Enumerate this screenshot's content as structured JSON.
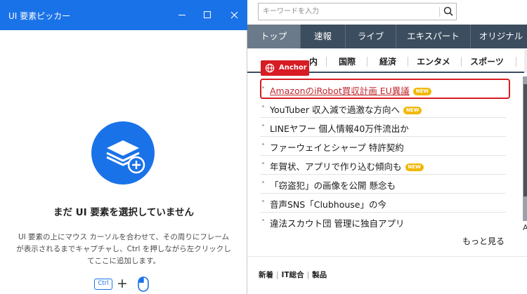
{
  "picker": {
    "title": "UI 要素ピッカー",
    "empty_heading": "まだ UI 要素を選択していません",
    "empty_description": "UI 要素の上にマウス カーソルを合わせて、その周りにフレームが表示されるまでキャプチャし、Ctrl を押しながら左クリックしてここに追加します。",
    "ctrl_key_label": "Ctrl",
    "plus_label": "+",
    "icons": {
      "hero": "stacked-layers-add-icon",
      "mouse": "mouse-left-click-icon"
    },
    "accent_color": "#1a72e8"
  },
  "browser": {
    "search": {
      "placeholder": "キーワードを入力",
      "value": ""
    },
    "nav_primary": [
      {
        "label": "トップ",
        "active": true
      },
      {
        "label": "速報",
        "active": false
      },
      {
        "label": "ライブ",
        "active": false
      },
      {
        "label": "エキスパート",
        "active": false
      },
      {
        "label": "オリジナル",
        "active": false
      }
    ],
    "nav_secondary": [
      "国内",
      "国際",
      "経済",
      "エンタメ",
      "スポーツ"
    ],
    "nav_secondary_first_partial": "内",
    "anchor_badge": {
      "label": "Anchor",
      "color": "#d71c24"
    },
    "news": [
      {
        "title": "AmazonのiRobot買収計画 EU異議",
        "new": true,
        "highlighted": true
      },
      {
        "title": "YouTuber 収入減で過激な方向へ",
        "new": true,
        "highlighted": false
      },
      {
        "title": "LINEヤフー 個人情報40万件流出か",
        "new": false,
        "highlighted": false
      },
      {
        "title": "ファーウェイとシャープ 特許契約",
        "new": false,
        "highlighted": false
      },
      {
        "title": "年賀状、アプリで作り込む傾向も",
        "new": true,
        "highlighted": false
      },
      {
        "title": "「窃盗犯」の画像を公開 懸念も",
        "new": false,
        "highlighted": false
      },
      {
        "title": "音声SNS「Clubhouse」の今",
        "new": false,
        "highlighted": false
      },
      {
        "title": "違法スカウト団 管理に独自アプリ",
        "new": false,
        "highlighted": false
      }
    ],
    "new_tag_label": "NEW",
    "more_link": "もっと見る",
    "footer_tabs": [
      "新着",
      "IT総合",
      "製品"
    ],
    "side_glyph": "A"
  }
}
